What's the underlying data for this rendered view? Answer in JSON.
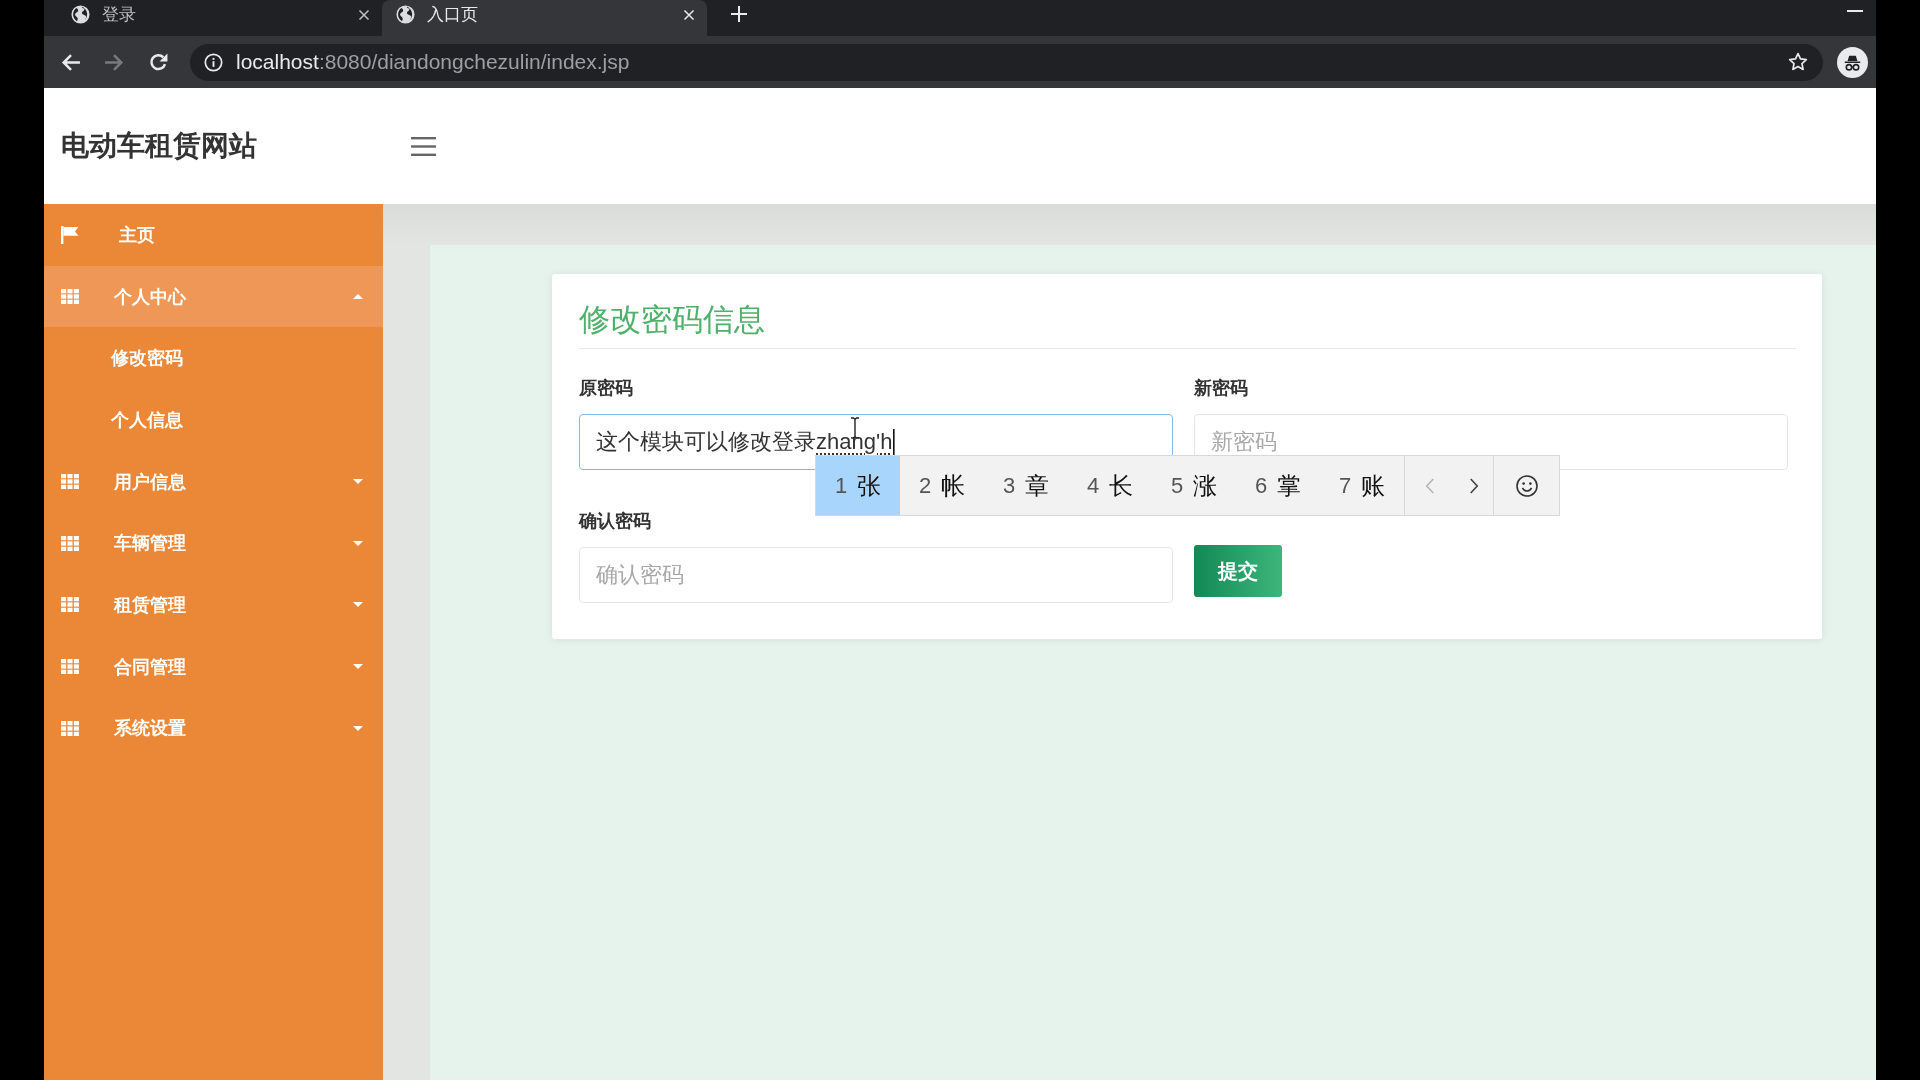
{
  "browser": {
    "tabs": [
      {
        "title": "登录",
        "selected": false
      },
      {
        "title": "入口页",
        "selected": true
      }
    ],
    "navigation": [
      {
        "kind": "back",
        "disabled": false
      },
      {
        "kind": "forward",
        "disabled": true
      },
      {
        "kind": "reload",
        "disabled": false
      }
    ],
    "address_bar": {
      "host": "localhost",
      "path": ":8080/diandongchezulin/index.jsp"
    }
  },
  "header": {
    "site_title": "电动车租赁网站"
  },
  "sidebar": {
    "items": [
      {
        "kind": "link",
        "label": "主页"
      },
      {
        "kind": "group",
        "label": "个人中心",
        "expanded": true,
        "children": [
          {
            "label": "修改密码"
          },
          {
            "label": "个人信息"
          }
        ]
      },
      {
        "kind": "group",
        "label": "用户信息",
        "expanded": false
      },
      {
        "kind": "group",
        "label": "车辆管理",
        "expanded": false
      },
      {
        "kind": "group",
        "label": "租赁管理",
        "expanded": false
      },
      {
        "kind": "group",
        "label": "合同管理",
        "expanded": false
      },
      {
        "kind": "group",
        "label": "系统设置",
        "expanded": false
      }
    ]
  },
  "form": {
    "title": "修改密码信息",
    "fields": [
      {
        "label": "原密码",
        "value": "这个模块可以修改登录",
        "composition": "zhang'h",
        "focused": true
      },
      {
        "label": "新密码",
        "placeholder": "新密码",
        "focused": false
      },
      {
        "label": "确认密码",
        "placeholder": "确认密码",
        "focused": false
      }
    ],
    "submit": "提交"
  },
  "ime": {
    "candidates": [
      {
        "number": "1",
        "text": "张",
        "selected": true
      },
      {
        "number": "2",
        "text": "帐",
        "selected": false
      },
      {
        "number": "3",
        "text": "章",
        "selected": false
      },
      {
        "number": "4",
        "text": "长",
        "selected": false
      },
      {
        "number": "5",
        "text": "涨",
        "selected": false
      },
      {
        "number": "6",
        "text": "掌",
        "selected": false
      },
      {
        "number": "7",
        "text": "账",
        "selected": false
      }
    ],
    "paging": [
      {
        "kind": "previous",
        "disabled": true
      },
      {
        "kind": "next",
        "disabled": false
      }
    ]
  }
}
